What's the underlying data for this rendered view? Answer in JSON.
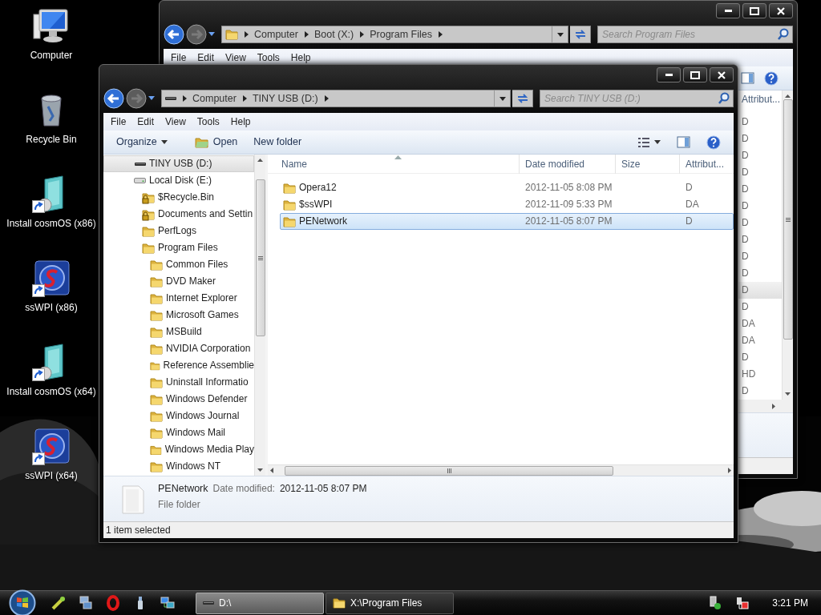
{
  "desktop_icons": [
    {
      "label": "Computer",
      "kind": "computer",
      "shortcut": false
    },
    {
      "label": "Recycle Bin",
      "kind": "bin",
      "shortcut": false
    },
    {
      "label": "Install cosmOS (x86)",
      "kind": "installer",
      "shortcut": true
    },
    {
      "label": "ssWPI (x86)",
      "kind": "app",
      "shortcut": true
    },
    {
      "label": "Install cosmOS (x64)",
      "kind": "installer",
      "shortcut": true
    },
    {
      "label": "ssWPI (x64)",
      "kind": "app",
      "shortcut": true
    }
  ],
  "back_window": {
    "address": [
      "Computer",
      "Boot (X:)",
      "Program Files"
    ],
    "search": {
      "placeholder": "Search Program Files"
    },
    "menu": [
      "File",
      "Edit",
      "View",
      "Tools",
      "Help"
    ],
    "column_header": "Attribut...",
    "attributes": [
      {
        "text": "D",
        "selected": false
      },
      {
        "text": "D",
        "selected": false
      },
      {
        "text": "D",
        "selected": false
      },
      {
        "text": "D",
        "selected": false
      },
      {
        "text": "D",
        "selected": false
      },
      {
        "text": "D",
        "selected": false
      },
      {
        "text": "D",
        "selected": false
      },
      {
        "text": "D",
        "selected": false
      },
      {
        "text": "D",
        "selected": false
      },
      {
        "text": "D",
        "selected": false
      },
      {
        "text": "D",
        "selected": true
      },
      {
        "text": "D",
        "selected": false
      },
      {
        "text": "DA",
        "selected": false
      },
      {
        "text": "DA",
        "selected": false
      },
      {
        "text": "D",
        "selected": false
      },
      {
        "text": "HD",
        "selected": false
      },
      {
        "text": "D",
        "selected": false
      }
    ]
  },
  "front_window": {
    "address": [
      "Computer",
      "TINY USB (D:)"
    ],
    "search": {
      "placeholder": "Search TINY USB (D:)"
    },
    "menu": [
      "File",
      "Edit",
      "View",
      "Tools",
      "Help"
    ],
    "toolbar": [
      {
        "label": "Organize",
        "kind": "menu"
      },
      {
        "label": "Open",
        "kind": "open"
      },
      {
        "label": "New folder",
        "kind": "plain"
      }
    ],
    "tree": [
      {
        "label": "TINY USB (D:)",
        "kind": "usb",
        "selected": true
      },
      {
        "label": "Local Disk (E:)",
        "kind": "disk",
        "selected": false,
        "children": [
          {
            "label": "$Recycle.Bin",
            "kind": "locked",
            "selected": false
          },
          {
            "label": "Documents and Settin",
            "kind": "locked",
            "selected": false
          },
          {
            "label": "PerfLogs",
            "kind": "folder",
            "selected": false
          },
          {
            "label": "Program Files",
            "kind": "folder",
            "selected": false,
            "children": [
              {
                "label": "Common Files",
                "kind": "folder",
                "selected": false
              },
              {
                "label": "DVD Maker",
                "kind": "folder",
                "selected": false
              },
              {
                "label": "Internet Explorer",
                "kind": "folder",
                "selected": false
              },
              {
                "label": "Microsoft Games",
                "kind": "folder",
                "selected": false
              },
              {
                "label": "MSBuild",
                "kind": "folder",
                "selected": false
              },
              {
                "label": "NVIDIA Corporation",
                "kind": "folder",
                "selected": false
              },
              {
                "label": "Reference Assemblie",
                "kind": "folder",
                "selected": false
              },
              {
                "label": "Uninstall Informatio",
                "kind": "folder",
                "selected": false
              },
              {
                "label": "Windows Defender",
                "kind": "folder",
                "selected": false
              },
              {
                "label": "Windows Journal",
                "kind": "folder",
                "selected": false
              },
              {
                "label": "Windows Mail",
                "kind": "folder",
                "selected": false
              },
              {
                "label": "Windows Media Play",
                "kind": "folder",
                "selected": false
              },
              {
                "label": "Windows NT",
                "kind": "folder",
                "selected": false
              }
            ]
          }
        ]
      }
    ],
    "columns": [
      "Name",
      "Date modified",
      "Size",
      "Attribut..."
    ],
    "rows": [
      {
        "name": "Opera12",
        "date_modified": "2012-11-05 8:08 PM",
        "attributes": "D",
        "selected": false
      },
      {
        "name": "$ssWPI",
        "date_modified": "2012-11-09 5:33 PM",
        "attributes": "DA",
        "selected": false
      },
      {
        "name": "PENetwork",
        "date_modified": "2012-11-05 8:07 PM",
        "attributes": "D",
        "selected": true
      }
    ],
    "details": {
      "name": "PENetwork",
      "date_label": "Date modified:",
      "date_value": "2012-11-05 8:07 PM",
      "type": "File folder"
    },
    "status": "1 item selected"
  },
  "taskbar": {
    "tasks": [
      {
        "label": "D:\\",
        "kind": "drive",
        "selected": true
      },
      {
        "label": "X:\\Program Files",
        "kind": "folder",
        "selected": false
      }
    ],
    "clock": "3:21 PM"
  }
}
